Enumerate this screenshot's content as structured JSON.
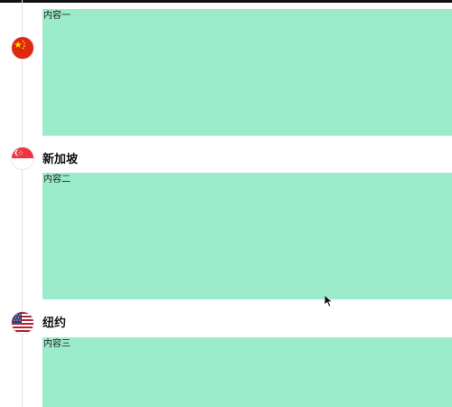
{
  "timeline": {
    "items": [
      {
        "flag": "china-flag-icon",
        "title": "",
        "content": "内容一"
      },
      {
        "flag": "singapore-flag-icon",
        "title": "新加坡",
        "content": "内容二"
      },
      {
        "flag": "usa-flag-icon",
        "title": "纽约",
        "content": "内容三"
      }
    ]
  },
  "colors": {
    "panel": "#9aebc9",
    "line": "#e2e2e2",
    "china_red": "#de2910",
    "china_yellow": "#ffde00",
    "singapore_red": "#ef3340",
    "usa_red": "#b22234",
    "usa_blue": "#3c3b6e"
  },
  "cursor": "mouse-pointer-icon"
}
